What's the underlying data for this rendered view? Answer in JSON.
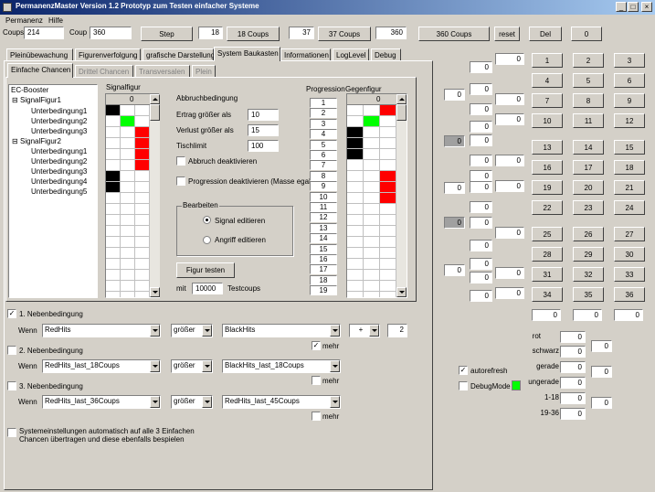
{
  "window": {
    "title": "PermanenzMaster Version 1.2 Prototyp zum Testen einfacher Systeme",
    "min": "_",
    "max": "□",
    "close": "×"
  },
  "menu": [
    "Permanenz",
    "Hilfe"
  ],
  "toolbar": {
    "coups_label": "Coups",
    "coups_value": "214",
    "coup_label": "Coup",
    "coup_value": "360",
    "step": "Step",
    "v18": "18",
    "b18": "18  Coups",
    "v37": "37",
    "b37": "37  Coups",
    "v360": "360",
    "b360": "360  Coups",
    "reset": "reset",
    "del": "Del",
    "zero": "0"
  },
  "tabs": [
    "Pleinübewachung",
    "Figurenverfolgung",
    "grafische Darstellung",
    "System Baukasten",
    "Informationen",
    "LogLevel",
    "Debug"
  ],
  "subtabs": [
    "Einfache Chancen",
    "Drittel Chancen",
    "Transversalen",
    "Plein"
  ],
  "tree": {
    "root": "EC-Booster",
    "f1": "SignalFigur1",
    "f1c": [
      "Unterbedingung1",
      "Unterbedingung2",
      "Unterbedingung3"
    ],
    "f2": "SignalFigur2",
    "f2c": [
      "Unterbedingung1",
      "Unterbedingung2",
      "Unterbedingung3",
      "Unterbedingung4",
      "Unterbedingung5"
    ]
  },
  "signal": {
    "label": "Signalfigur",
    "header": "0"
  },
  "abbruch": {
    "title": "Abbruchbedingung",
    "ertrag_label": "Ertrag größer als",
    "ertrag": "10",
    "verlust_label": "Verlust größer als",
    "verlust": "15",
    "tisch_label": "Tischlimit",
    "tisch": "100",
    "abbruch_deakt": "Abbruch deaktivieren",
    "prog_deakt": "Progression deaktivieren (Masse egal)"
  },
  "bearbeiten": {
    "title": "Bearbeiten",
    "signal": "Signal editieren",
    "angriff": "Angriff editieren"
  },
  "figur_testen": "Figur testen",
  "mit": "mit",
  "mit_value": "10000",
  "testcoups": "Testcoups",
  "progression": {
    "label": "Progression",
    "values": [
      "1",
      "2",
      "3",
      "4",
      "5",
      "6",
      "7",
      "8",
      "9",
      "10",
      "11",
      "12",
      "13",
      "14",
      "15",
      "16",
      "17",
      "18",
      "19"
    ]
  },
  "gegen": {
    "label": "Gegenfigur",
    "header": "0"
  },
  "neben": [
    {
      "label": "1. Nebenbedingung",
      "checked": "✓",
      "wenn": "Wenn",
      "a": "RedHits",
      "op": "größer",
      "b": "BlackHits",
      "mehr": "mehr",
      "mehr_checked": "✓",
      "plus": "+",
      "n": "2"
    },
    {
      "label": "2. Nebenbedingung",
      "checked": "",
      "wenn": "Wenn",
      "a": "RedHits_last_18Coups",
      "op": "größer",
      "b": "BlackHits_last_18Coups",
      "mehr": "mehr",
      "mehr_checked": ""
    },
    {
      "label": "3. Nebenbedingung",
      "checked": "",
      "wenn": "Wenn",
      "a": "RedHits_last_36Coups",
      "op": "größer",
      "b": "RedHits_last_45Coups",
      "mehr": "mehr",
      "mehr_checked": ""
    }
  ],
  "sysline1": "Systemeinstellungen automatisch auf alle 3 Einfachen",
  "sysline2": "Chancen übertragen und diese ebenfalls bespielen",
  "right": {
    "numbers": [
      "1",
      "2",
      "3",
      "4",
      "5",
      "6",
      "7",
      "8",
      "9",
      "10",
      "11",
      "12",
      "13",
      "14",
      "15",
      "16",
      "17",
      "18",
      "19",
      "20",
      "21",
      "22",
      "23",
      "24",
      "25",
      "26",
      "27",
      "28",
      "29",
      "30",
      "31",
      "32",
      "33",
      "34",
      "35",
      "36"
    ],
    "zero": "0",
    "stats": [
      "rot",
      "schwarz",
      "gerade",
      "ungerade",
      "1-18",
      "19-36"
    ],
    "autorefresh": "autorefresh",
    "autorefresh_checked": "✓",
    "debug": "DebugMode",
    "debug_color": "#00ff00"
  },
  "colors": {
    "title_start": "#0a246a",
    "title_end": "#a6caf0",
    "red": "#ff0000",
    "green": "#00ff00",
    "black": "#000000"
  }
}
